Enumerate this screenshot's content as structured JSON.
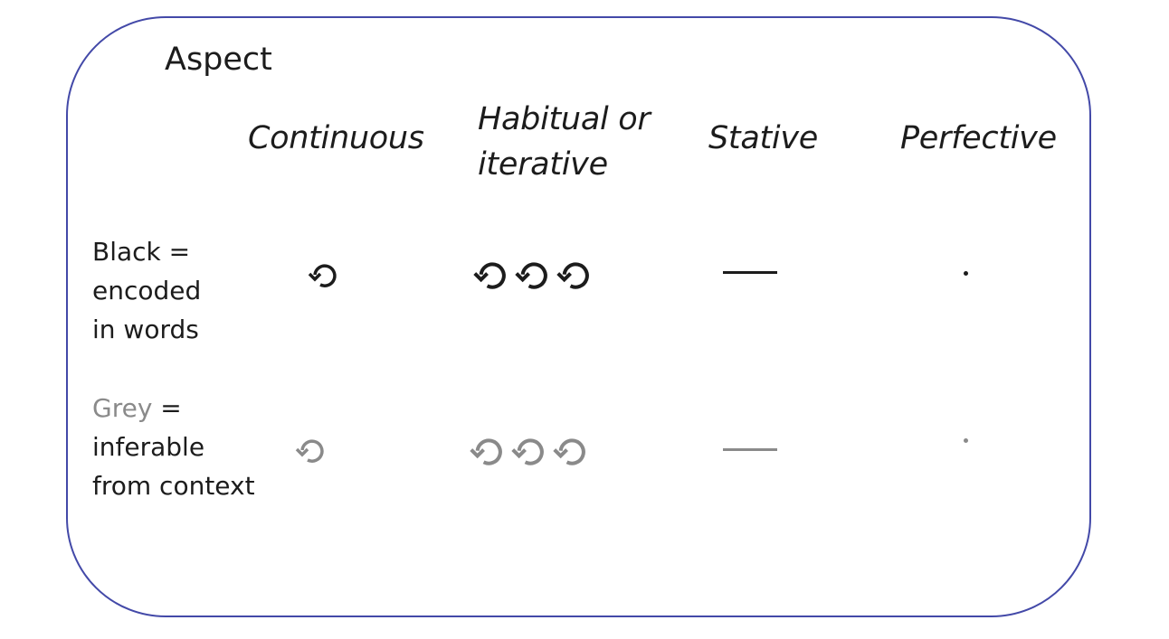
{
  "title": "Aspect",
  "columns": [
    {
      "label_line1": "Continuous",
      "label_line2": ""
    },
    {
      "label_line1": "Habitual or",
      "label_line2": "iterative"
    },
    {
      "label_line1": "Stative",
      "label_line2": ""
    },
    {
      "label_line1": "Perfective",
      "label_line2": ""
    }
  ],
  "rows": [
    {
      "word": "Black",
      "rest_line1": " =",
      "line2": "encoded",
      "line3": "in words",
      "color": "#1c1c1c"
    },
    {
      "word": "Grey",
      "rest_line1": " =",
      "line2": "inferable",
      "line3": "from context",
      "color": "#8a8a8a"
    }
  ],
  "symbols": {
    "continuous": "anticlockwise-arrow-icon",
    "habitual": "anticlockwise-arrow-icon x3",
    "stative": "horizontal-line-icon",
    "perfective": "dot-icon"
  },
  "colors": {
    "border": "#4349a8",
    "black": "#1c1c1c",
    "grey": "#8a8a8a"
  }
}
